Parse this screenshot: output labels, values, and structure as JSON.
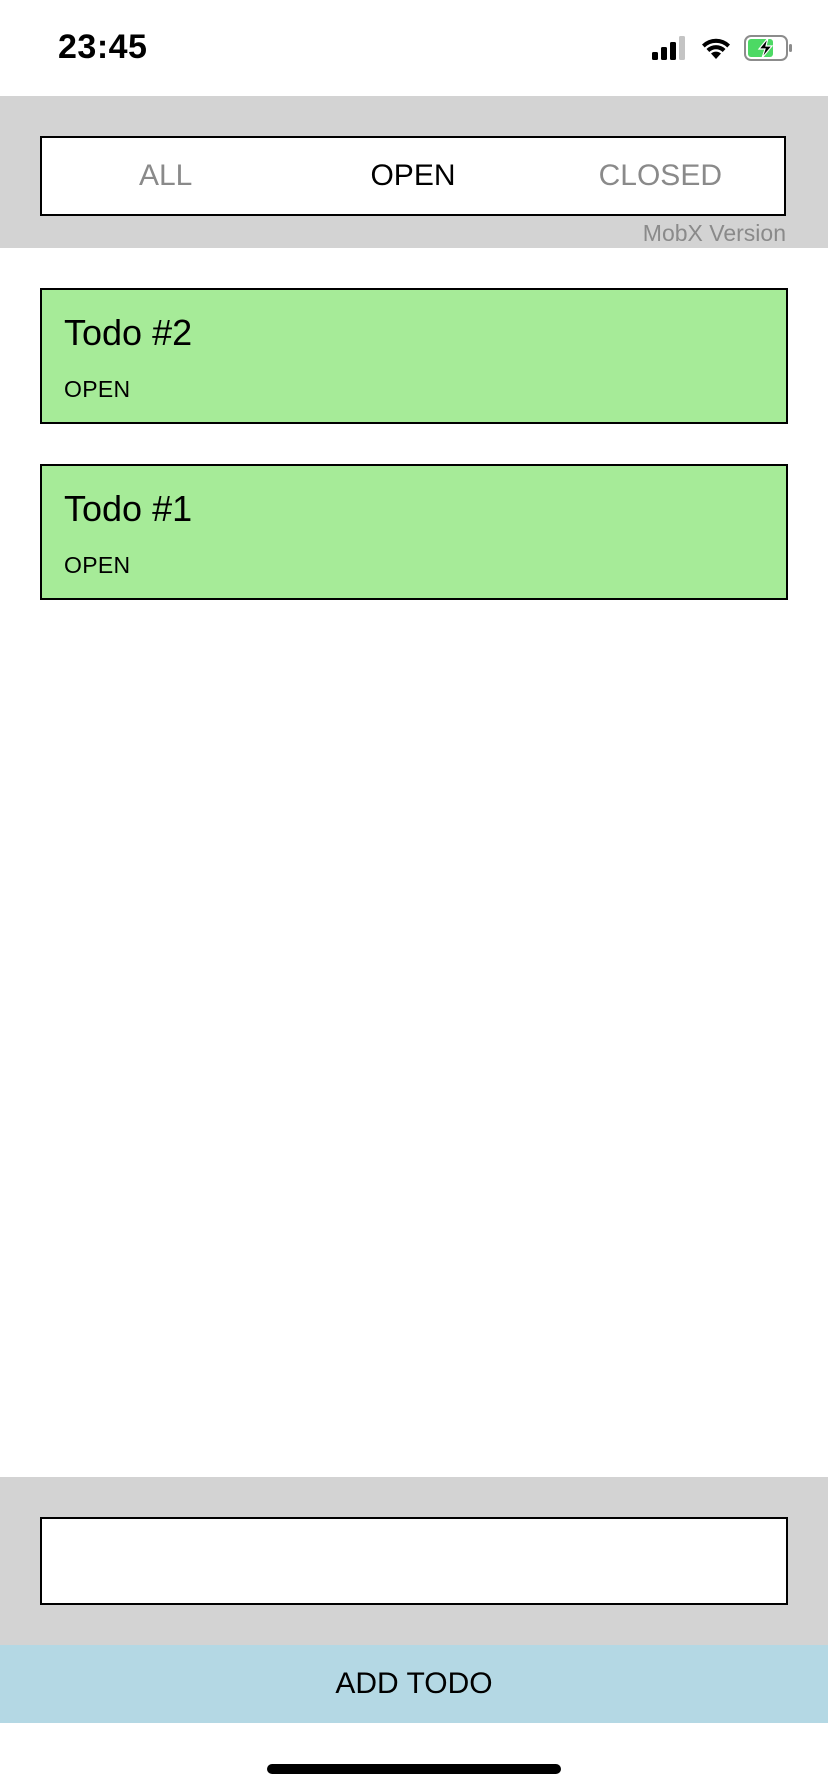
{
  "status_bar": {
    "time": "23:45",
    "icons": [
      "cellular-signal-icon",
      "wifi-icon",
      "battery-charging-icon"
    ]
  },
  "filter": {
    "tabs": [
      {
        "label": "ALL",
        "active": false
      },
      {
        "label": "OPEN",
        "active": true
      },
      {
        "label": "CLOSED",
        "active": false
      }
    ],
    "version_label": "MobX Version"
  },
  "todos": [
    {
      "title": "Todo #2",
      "status": "OPEN"
    },
    {
      "title": "Todo #1",
      "status": "OPEN"
    }
  ],
  "input": {
    "value": "",
    "placeholder": ""
  },
  "add_button": {
    "label": "ADD TODO"
  },
  "colors": {
    "header_bg": "#d3d3d3",
    "todo_open_bg": "#a6eb98",
    "add_button_bg": "#b4d8e4",
    "inactive_tab_text": "#8a8a8a"
  }
}
